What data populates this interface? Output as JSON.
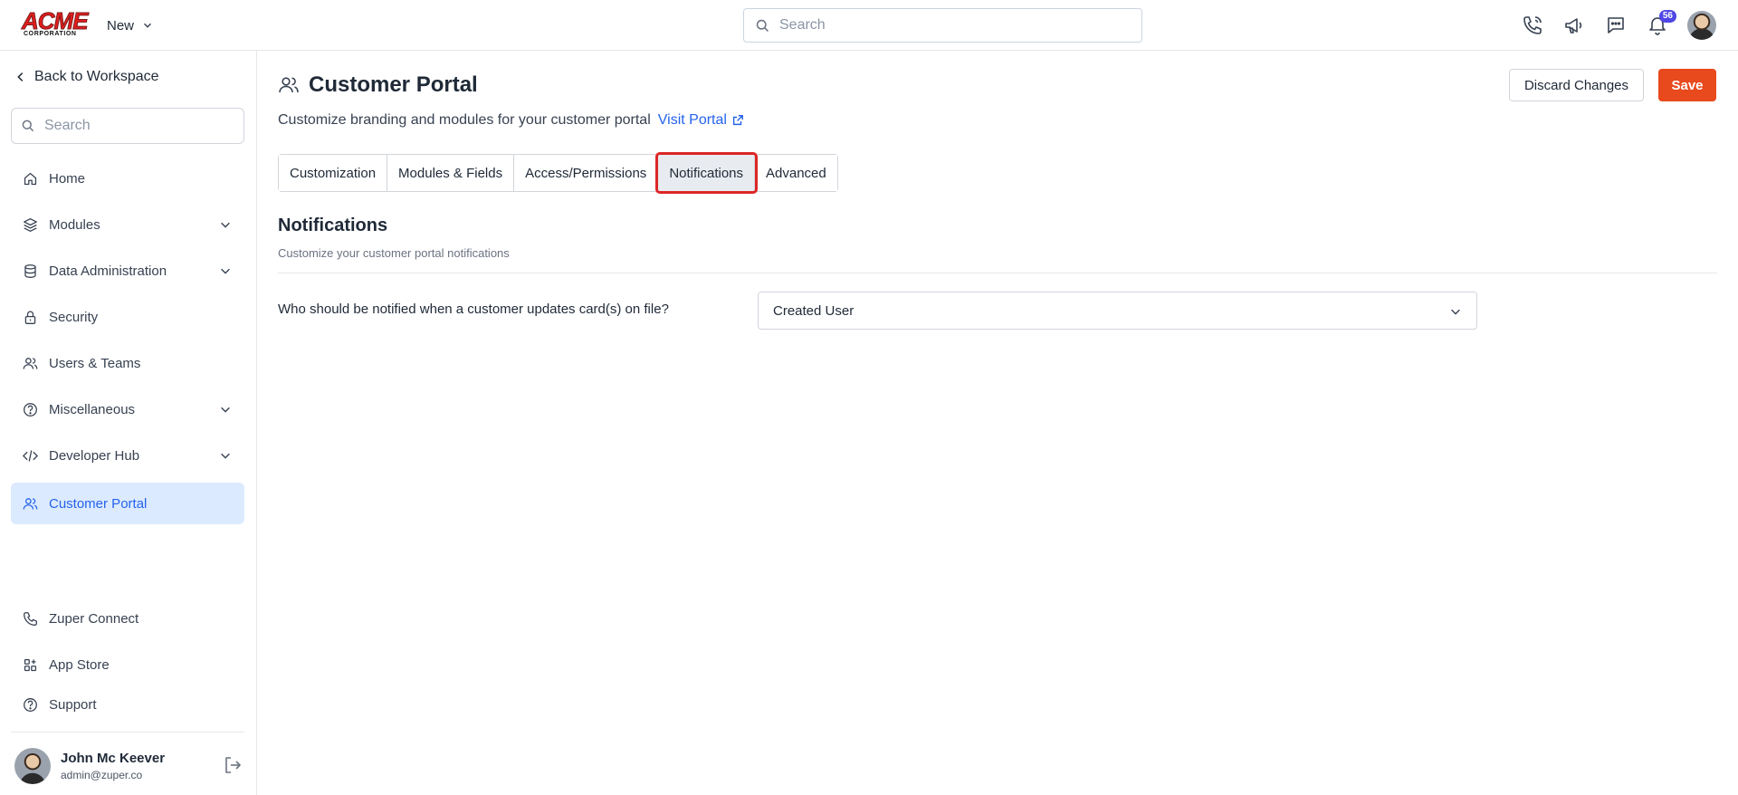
{
  "header": {
    "logo_text": "ACME",
    "logo_sub": "CORPORATION",
    "new_label": "New",
    "search_placeholder": "Search",
    "notification_count": "56"
  },
  "sidebar": {
    "back_label": "Back to Workspace",
    "search_placeholder": "Search",
    "items": [
      {
        "label": "Home"
      },
      {
        "label": "Modules"
      },
      {
        "label": "Data Administration"
      },
      {
        "label": "Security"
      },
      {
        "label": "Users & Teams"
      },
      {
        "label": "Miscellaneous"
      },
      {
        "label": "Developer Hub"
      },
      {
        "label": "Customer Portal"
      }
    ],
    "bottom_items": [
      {
        "label": "Zuper Connect"
      },
      {
        "label": "App Store"
      },
      {
        "label": "Support"
      }
    ],
    "user": {
      "name": "John Mc Keever",
      "email": "admin@zuper.co"
    }
  },
  "main": {
    "title": "Customer Portal",
    "subtitle": "Customize branding and modules for your customer portal",
    "visit_label": "Visit Portal",
    "discard_label": "Discard Changes",
    "save_label": "Save",
    "tabs": [
      {
        "label": "Customization"
      },
      {
        "label": "Modules & Fields"
      },
      {
        "label": "Access/Permissions"
      },
      {
        "label": "Notifications"
      },
      {
        "label": "Advanced"
      }
    ],
    "active_tab": "Notifications",
    "section": {
      "title": "Notifications",
      "subtitle": "Customize your customer portal notifications",
      "question": "Who should be notified when a customer updates card(s) on file?",
      "selected_value": "Created User"
    }
  },
  "colors": {
    "accent": "#2563eb",
    "save": "#e8491d",
    "active_nav_bg": "#dbeafe",
    "highlight": "#dc2626",
    "badge": "#4f46e5"
  }
}
